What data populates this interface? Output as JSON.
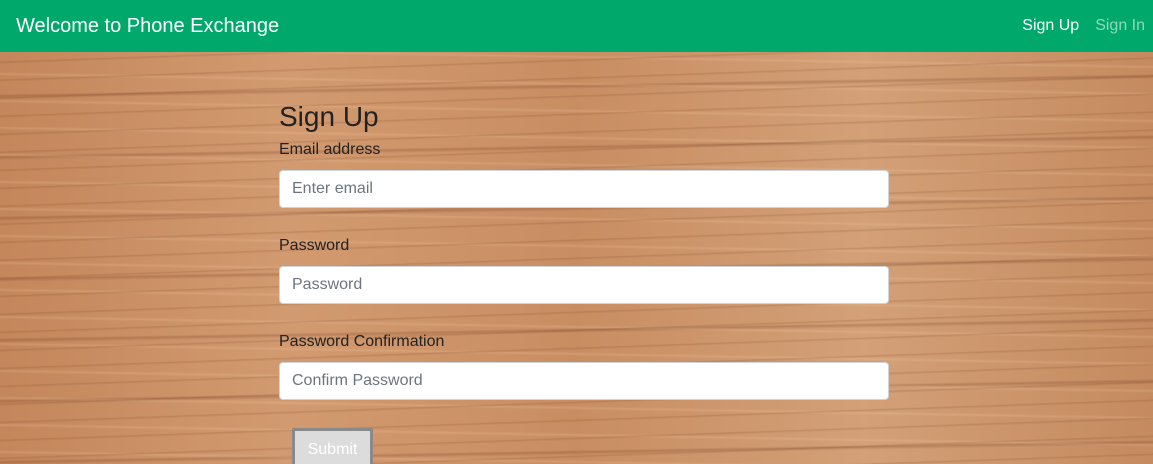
{
  "navbar": {
    "brand": "Welcome to Phone Exchange",
    "links": [
      {
        "label": "Sign Up"
      },
      {
        "label": "Sign In"
      }
    ]
  },
  "form": {
    "title": "Sign Up",
    "email": {
      "label": "Email address",
      "placeholder": "Enter email",
      "value": ""
    },
    "password": {
      "label": "Password",
      "placeholder": "Password",
      "value": ""
    },
    "confirm": {
      "label": "Password Confirmation",
      "placeholder": "Confirm Password",
      "value": ""
    },
    "submit_label": "Submit"
  },
  "colors": {
    "navbar_bg": "#00a86b",
    "background": "#c98f63",
    "submit_bg": "#dcdcdc"
  }
}
